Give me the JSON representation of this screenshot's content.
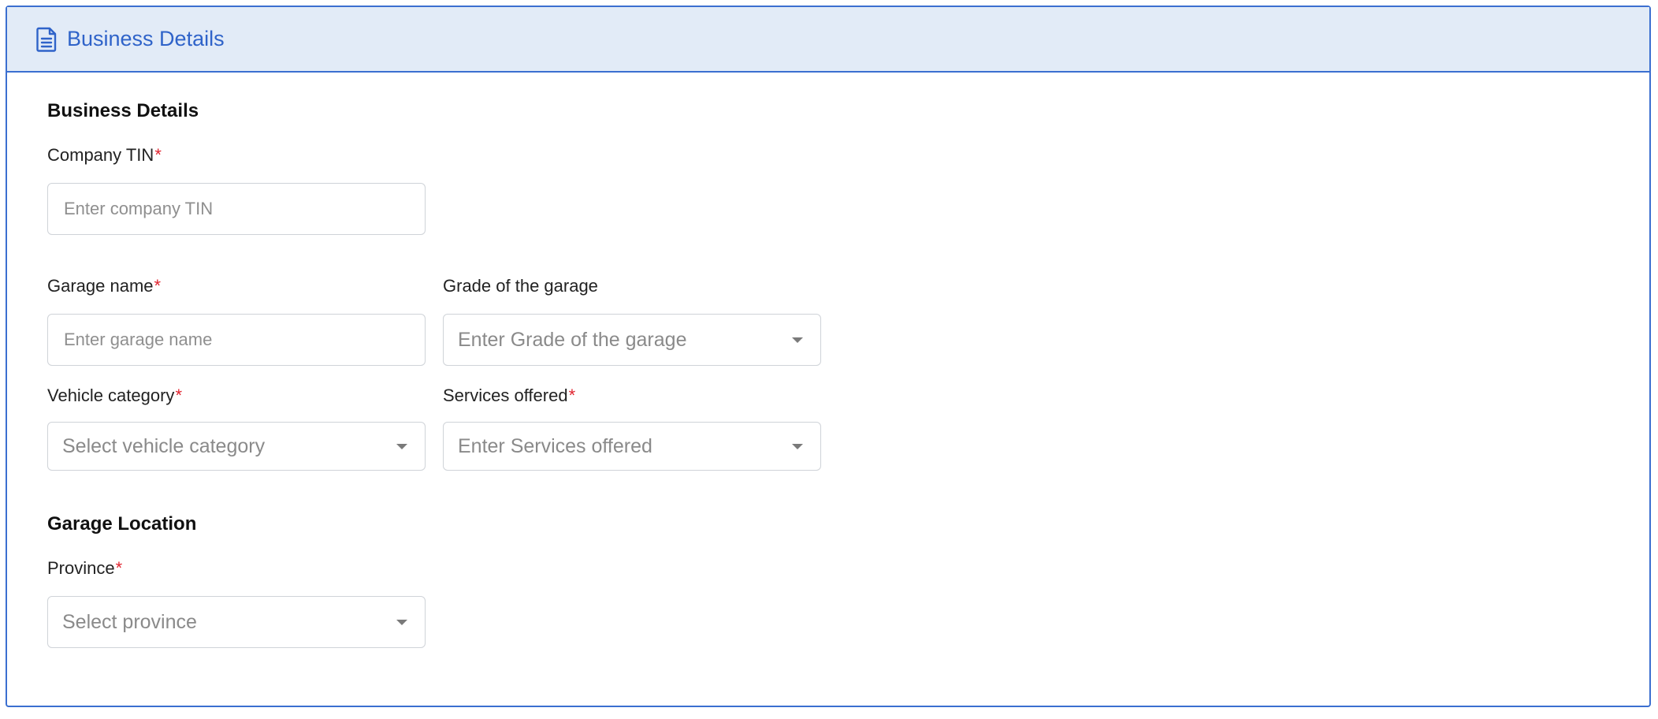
{
  "header": {
    "title": "Business Details",
    "icon": "document-icon",
    "accent_color": "#2f63c9"
  },
  "sections": {
    "business_details_title": "Business Details",
    "garage_location_title": "Garage Location"
  },
  "fields": {
    "company_tin": {
      "label": "Company TIN",
      "required_mark": "*",
      "placeholder": "Enter company TIN"
    },
    "garage_name": {
      "label": "Garage name",
      "required_mark": "*",
      "placeholder": "Enter garage name"
    },
    "grade_of_garage": {
      "label": "Grade of the garage",
      "placeholder": "Enter Grade of the garage"
    },
    "vehicle_category": {
      "label": "Vehicle category",
      "required_mark": "*",
      "placeholder": "Select vehicle category"
    },
    "services_offered": {
      "label": "Services offered",
      "required_mark": "*",
      "placeholder": "Enter Services offered"
    },
    "province": {
      "label": "Province",
      "required_mark": "*",
      "placeholder": "Select province"
    }
  }
}
